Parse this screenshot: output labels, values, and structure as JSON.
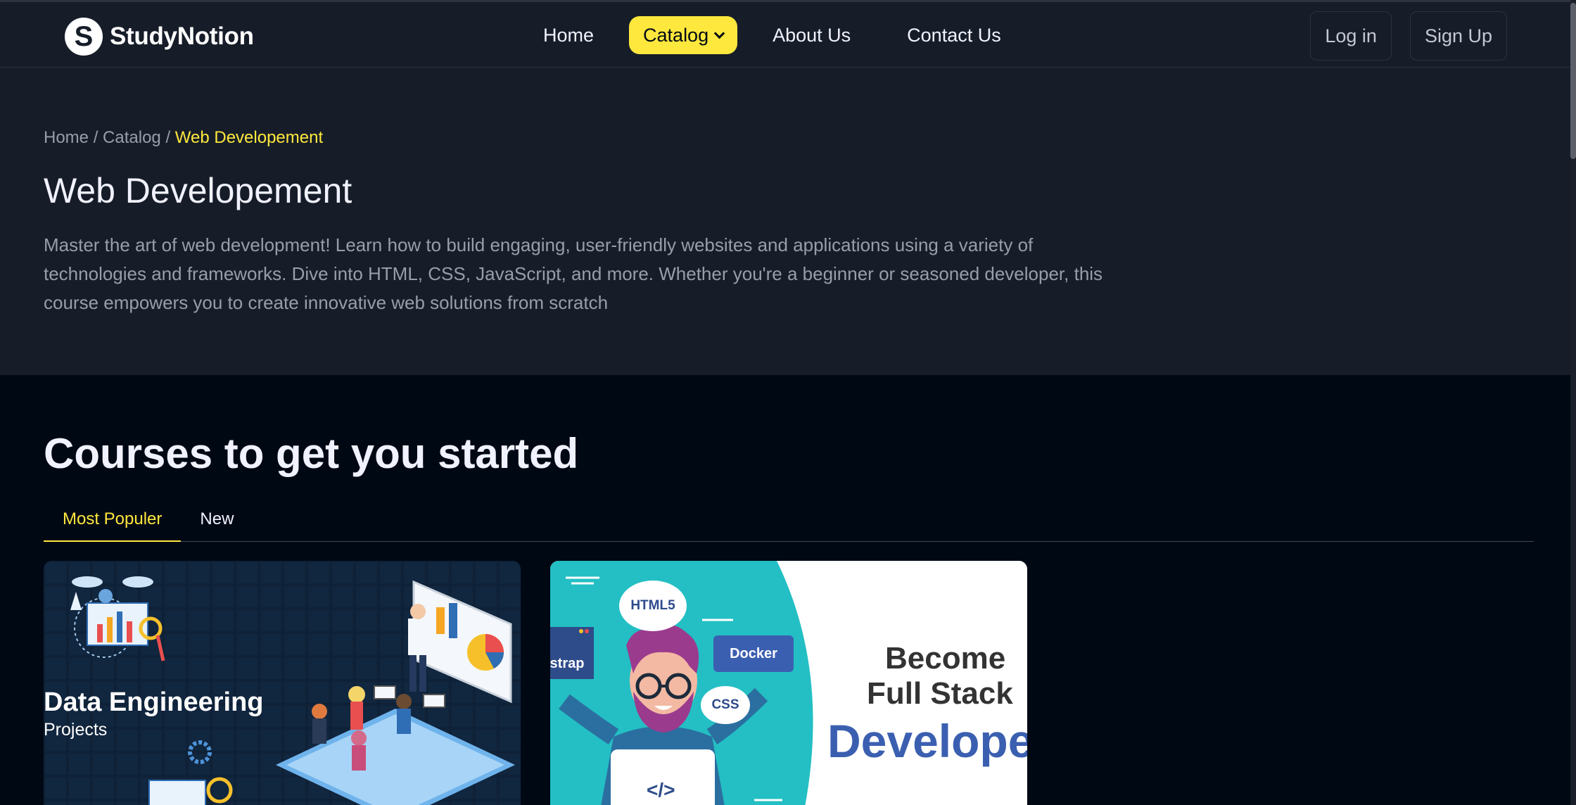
{
  "brand": {
    "name": "StudyNotion",
    "badge": "S"
  },
  "nav": {
    "home": "Home",
    "catalog": "Catalog",
    "about": "About Us",
    "contact": "Contact Us"
  },
  "auth": {
    "login": "Log in",
    "signup": "Sign Up"
  },
  "breadcrumb": {
    "home": "Home",
    "sep1": " / ",
    "catalog": "Catalog",
    "sep2": " / ",
    "current": "Web Developement"
  },
  "hero": {
    "title": "Web Developement",
    "description": "Master the art of web development! Learn how to build engaging, user-friendly websites and applications using a variety of technologies and frameworks. Dive into HTML, CSS, JavaScript, and more. Whether you're a beginner or seasoned developer, this course empowers you to create innovative web solutions from scratch"
  },
  "courses": {
    "title": "Courses to get you started",
    "tabs": [
      "Most Populer",
      "New"
    ]
  },
  "cards": [
    {
      "heading": "Data Engineering",
      "sub": "Projects"
    },
    {
      "bubbles": [
        "HTML5",
        "CSS"
      ],
      "tags": [
        "Docker",
        "strap"
      ],
      "code": "</>",
      "line1": "Become",
      "line2": "Full Stack",
      "line3": "Develope"
    }
  ],
  "colors": {
    "accent": "#FFE83D",
    "nav_bg": "#161D29",
    "page_bg": "#000814"
  }
}
